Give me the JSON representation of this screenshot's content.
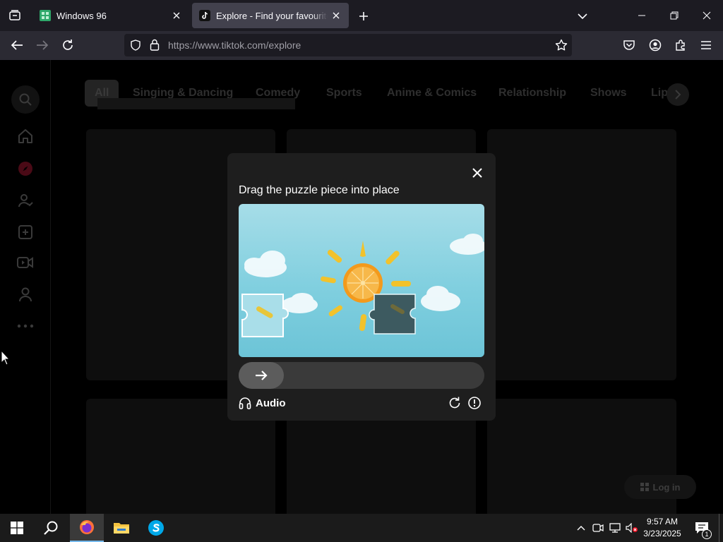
{
  "browser": {
    "tabs": [
      {
        "title": "Windows 96",
        "active": false
      },
      {
        "title": "Explore - Find your favourite videos on TikTok",
        "active": true
      }
    ],
    "url": {
      "scheme_host": "https://www.tiktok.com",
      "path": "/explore"
    }
  },
  "page": {
    "categories": [
      "All",
      "Singing & Dancing",
      "Comedy",
      "Sports",
      "Anime & Comics",
      "Relationship",
      "Shows",
      "Lip-sync"
    ],
    "sidebar_icons": [
      "search-icon",
      "home-icon",
      "explore-icon",
      "following-icon",
      "upload-icon",
      "live-icon",
      "profile-icon",
      "more-icon"
    ],
    "login_label": "Log in"
  },
  "captcha": {
    "title": "Drag the puzzle piece into place",
    "audio_label": "Audio",
    "slider_progress": 0
  },
  "taskbar": {
    "time": "9:57 AM",
    "date": "3/23/2025",
    "notification_count": "1"
  },
  "colors": {
    "chrome_dark": "#1c1b22",
    "chrome_tab_active": "#42414d",
    "captcha_bg": "#1e1e1e",
    "puzzle_sky": "#8fd4e2",
    "taskbar": "#1b1b1b"
  }
}
